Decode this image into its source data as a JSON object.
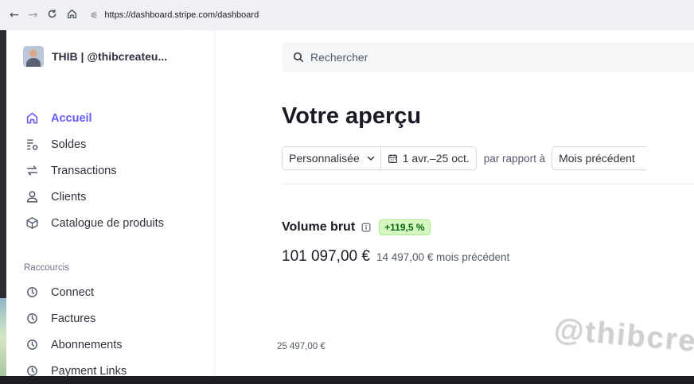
{
  "browser": {
    "back": "←",
    "forward": "→",
    "reload": "C",
    "home": "⌂",
    "url": "https://dashboard.stripe.com/dashboard"
  },
  "account": {
    "name": "THIB | @thibcreateu..."
  },
  "nav": {
    "items": [
      {
        "label": "Accueil",
        "icon": "home-icon",
        "active": true
      },
      {
        "label": "Soldes",
        "icon": "balances-icon"
      },
      {
        "label": "Transactions",
        "icon": "transactions-icon"
      },
      {
        "label": "Clients",
        "icon": "customers-icon"
      },
      {
        "label": "Catalogue de produits",
        "icon": "product-catalog-icon"
      }
    ]
  },
  "shortcuts": {
    "title": "Raccourcis",
    "items": [
      {
        "label": "Connect",
        "icon": "clock-icon"
      },
      {
        "label": "Factures",
        "icon": "clock-icon"
      },
      {
        "label": "Abonnements",
        "icon": "clock-icon"
      },
      {
        "label": "Payment Links",
        "icon": "clock-icon"
      }
    ]
  },
  "search": {
    "placeholder": "Rechercher"
  },
  "page": {
    "title": "Votre aperçu"
  },
  "filters": {
    "range_type": "Personnalisée",
    "date_range": "1 avr.–25 oct.",
    "compare_label": "par rapport à",
    "compare_period": "Mois précédent"
  },
  "metric": {
    "title": "Volume brut",
    "change": "+119,5 %",
    "value": "101 097,00 €",
    "previous": "14 497,00 € mois précédent",
    "axis_max_label": "25 497,00 €"
  },
  "watermark": "@thibcreateurdigital",
  "colors": {
    "accent": "#635bff",
    "positive_bg": "#d7f7c2",
    "positive_text": "#05690d"
  }
}
